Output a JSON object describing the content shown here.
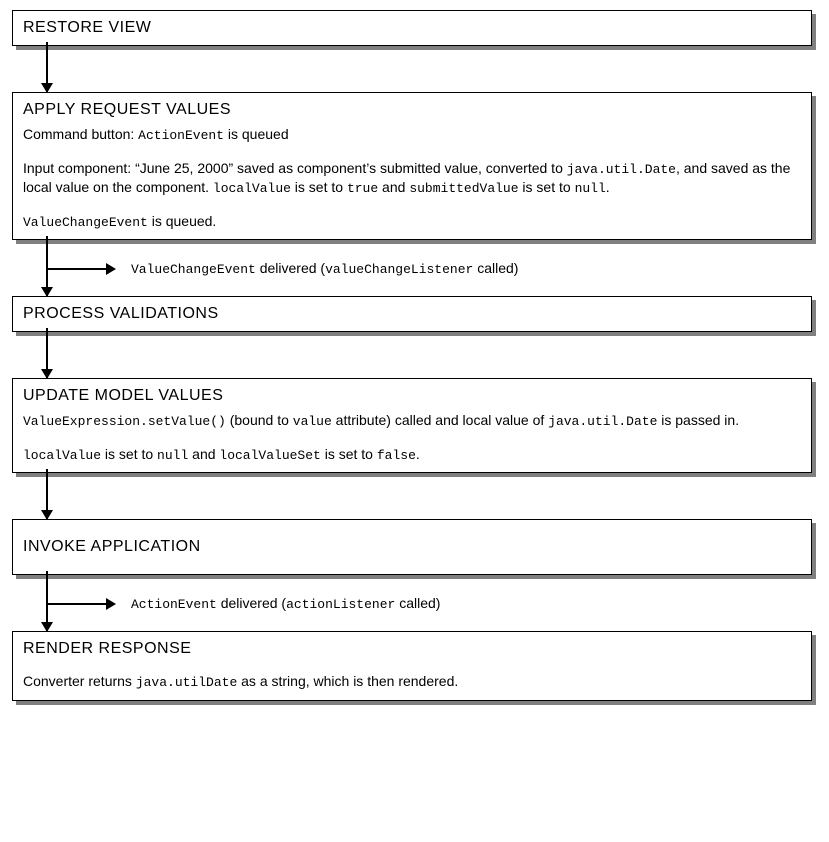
{
  "boxes": {
    "restore": {
      "title": "RESTORE VIEW"
    },
    "apply": {
      "title": "APPLY REQUEST VALUES",
      "l1_a": "Command button: ",
      "l1_code": "ActionEvent",
      "l1_b": " is queued",
      "l2_a": "Input component: “June 25, 2000” saved as component’s submitted value, converted to ",
      "l2_code1": "java.util.Date",
      "l2_b": ", and saved as the local value on the component. ",
      "l2_code2": "localValue",
      "l2_c": " is set to ",
      "l2_code3": "true",
      "l2_d": " and ",
      "l2_code4": "submittedValue",
      "l2_e": " is set to ",
      "l2_code5": "null",
      "l2_f": ".",
      "l3_code": "ValueChangeEvent",
      "l3_a": " is queued."
    },
    "process": {
      "title": "PROCESS VALIDATIONS"
    },
    "update": {
      "title": "UPDATE MODEL VALUES",
      "l1_code1": "ValueExpression.setValue()",
      "l1_a": " (bound to ",
      "l1_code2": "value",
      "l1_b": " attribute) called and local value of ",
      "l1_code3": "java.util.Date",
      "l1_c": " is passed in.",
      "l2_code1": "localValue",
      "l2_a": " is set to ",
      "l2_code2": "null",
      "l2_b": " and ",
      "l2_code3": "localValueSet",
      "l2_c": " is set to ",
      "l2_code4": "false",
      "l2_d": "."
    },
    "invoke": {
      "title": "INVOKE APPLICATION"
    },
    "render": {
      "title": "RENDER RESPONSE",
      "l1_a": "Converter returns ",
      "l1_code": "java.utilDate",
      "l1_b": " as a string, which is then rendered."
    }
  },
  "edges": {
    "e2_code1": "ValueChangeEvent",
    "e2_a": " delivered (",
    "e2_code2": "valueChangeListener",
    "e2_b": " called)",
    "e5_code1": "ActionEvent",
    "e5_a": " delivered (",
    "e5_code2": "actionListener",
    "e5_b": " called)"
  }
}
